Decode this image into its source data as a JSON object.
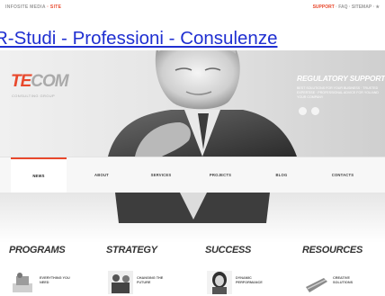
{
  "topbar": {
    "left_text": "INFOSITE MEDIA",
    "left_accent": "· SITE",
    "right_accent": "SUPPORT",
    "right_text": "· FAQ · SITEMAP · ★"
  },
  "overlay": {
    "link_text": "R-Studi - Professioni - Consulenze"
  },
  "hero": {
    "logo_te": "TE",
    "logo_com": "COM",
    "logo_sub": "CONSULTING GROUP",
    "reg_title": "REGULATORY SUPPORT",
    "reg_text": "BEST SOLUTIONS FOR YOUR BUSINESS · TRUSTED EXPERTISE · PROFESSIONAL ADVICE FOR YOU AND YOUR COMPANY"
  },
  "nav": {
    "items": [
      "NEWS",
      "ABOUT",
      "SERVICES",
      "PROJECTS",
      "BLOG",
      "CONTACTS"
    ]
  },
  "sections": [
    {
      "title": "PROGRAMS",
      "label": "EVERYTHING YOU NEED"
    },
    {
      "title": "STRATEGY",
      "label": "CHANGING THE FUTURE"
    },
    {
      "title": "SUCCESS",
      "label": "DYNAMIC PERFORMANCE"
    },
    {
      "title": "RESOURCES",
      "label": "CREATIVE SOLUTIONS"
    }
  ],
  "colors": {
    "accent": "#e8482c",
    "link": "#1f2fd1"
  }
}
